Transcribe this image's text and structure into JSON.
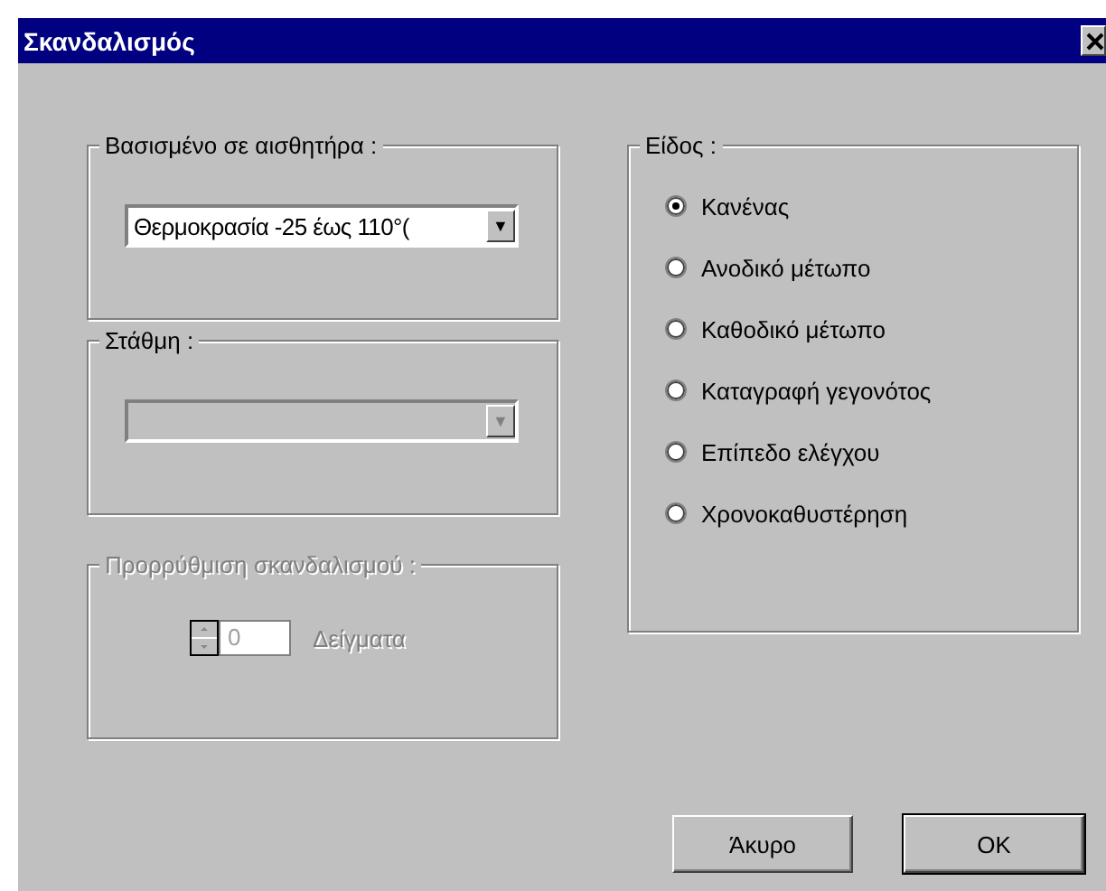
{
  "window": {
    "title": "Σκανδαλισμός"
  },
  "sensor_group": {
    "label": "Βασισμένο σε αισθητήρα :",
    "disabled": false,
    "dropdown": {
      "value": "Θερμοκρασία -25 έως 110°(",
      "arrow": "▼",
      "disabled": false
    }
  },
  "level_group": {
    "label": "Στάθμη :",
    "disabled": false,
    "dropdown": {
      "arrow": "▼",
      "disabled": true
    }
  },
  "pretrigger_group": {
    "label": "Προρρύθμιση σκανδαλισμού :",
    "disabled": true,
    "spinner": {
      "value": "0",
      "disabled": true
    },
    "unit": "Δείγματα"
  },
  "type_group": {
    "label": "Είδος :",
    "options": [
      {
        "label": "Κανένας",
        "selected": true
      },
      {
        "label": "Ανοδικό μέτωπο",
        "selected": false
      },
      {
        "label": "Καθοδικό μέτωπο",
        "selected": false
      },
      {
        "label": "Καταγραφή γεγονότος",
        "selected": false
      },
      {
        "label": "Επίπεδο ελέγχου",
        "selected": false
      },
      {
        "label": "Χρονοκαθυστέρηση",
        "selected": false
      }
    ]
  },
  "buttons": [
    {
      "label": "Άκυρο",
      "default": false
    },
    {
      "label": "OK",
      "default": true
    }
  ]
}
